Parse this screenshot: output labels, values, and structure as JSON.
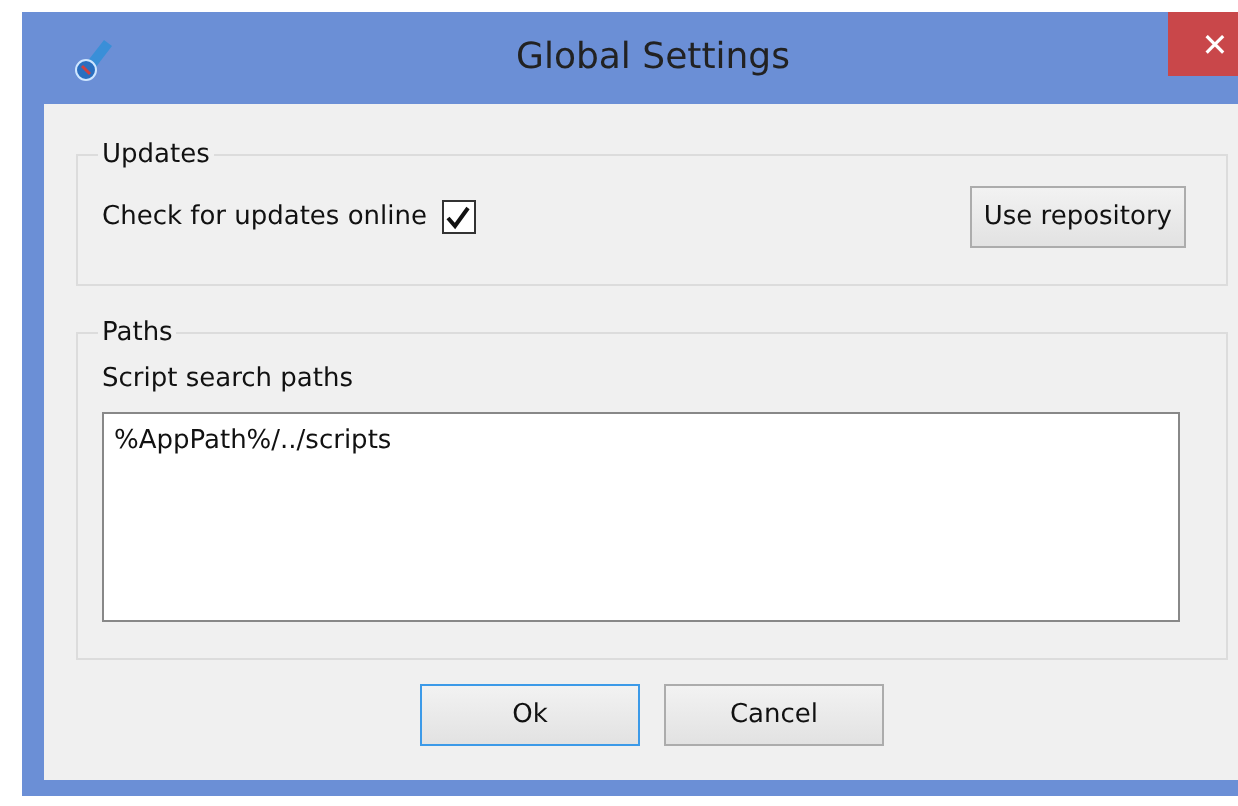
{
  "window": {
    "title": "Global Settings",
    "close": "✕"
  },
  "updates": {
    "title": "Updates",
    "check_label": "Check for updates online",
    "checked": true,
    "button": "Use repository"
  },
  "paths": {
    "title": "Paths",
    "label": "Script search paths",
    "value": "%AppPath%/../scripts"
  },
  "buttons": [
    {
      "label": "Ok",
      "default": true
    },
    {
      "label": "Cancel",
      "default": false
    }
  ]
}
